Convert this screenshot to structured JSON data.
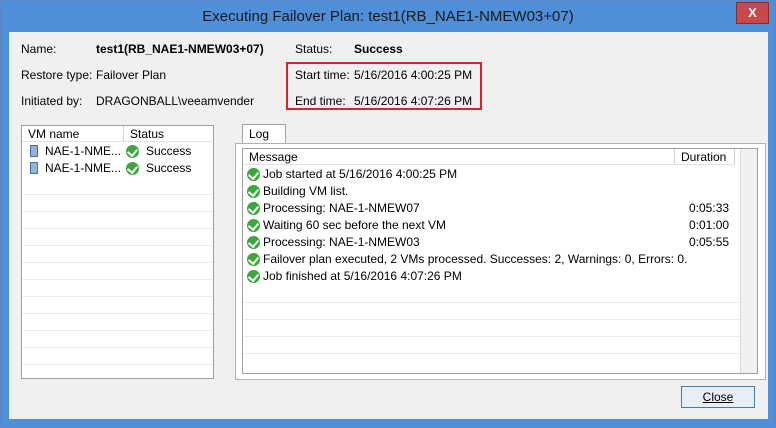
{
  "window": {
    "title": "Executing Failover Plan: test1(RB_NAE1-NMEW03+07)",
    "close_glyph": "X"
  },
  "info": {
    "name_label": "Name:",
    "name_value": "test1(RB_NAE1-NMEW03+07)",
    "status_label": "Status:",
    "status_value": "Success",
    "restore_type_label": "Restore type:",
    "restore_type_value": "Failover Plan",
    "start_time_label": "Start time:",
    "start_time_value": "5/16/2016 4:00:25 PM",
    "initiated_by_label": "Initiated by:",
    "initiated_by_value": "DRAGONBALL\\veeamvender",
    "end_time_label": "End time:",
    "end_time_value": "5/16/2016 4:07:26 PM"
  },
  "vm_list": {
    "columns": [
      "VM name",
      "Status"
    ],
    "rows": [
      {
        "name": "NAE-1-NME...",
        "status": "Success"
      },
      {
        "name": "NAE-1-NME...",
        "status": "Success"
      }
    ]
  },
  "log_tab": {
    "label": "Log"
  },
  "log": {
    "columns": [
      "Message",
      "Duration"
    ],
    "rows": [
      {
        "message": "Job started at 5/16/2016 4:00:25 PM",
        "duration": ""
      },
      {
        "message": "Building VM list.",
        "duration": ""
      },
      {
        "message": "Processing: NAE-1-NMEW07",
        "duration": "0:05:33"
      },
      {
        "message": "Waiting 60 sec before the next VM",
        "duration": "0:01:00"
      },
      {
        "message": "Processing: NAE-1-NMEW03",
        "duration": "0:05:55"
      },
      {
        "message": "Failover plan executed, 2 VMs processed. Successes: 2, Warnings: 0, Errors: 0.",
        "duration": ""
      },
      {
        "message": "Job finished at 5/16/2016 4:07:26 PM",
        "duration": ""
      }
    ]
  },
  "buttons": {
    "close_label": "Close"
  },
  "icons": {
    "status": "success-check-icon",
    "vm": "server-icon"
  }
}
